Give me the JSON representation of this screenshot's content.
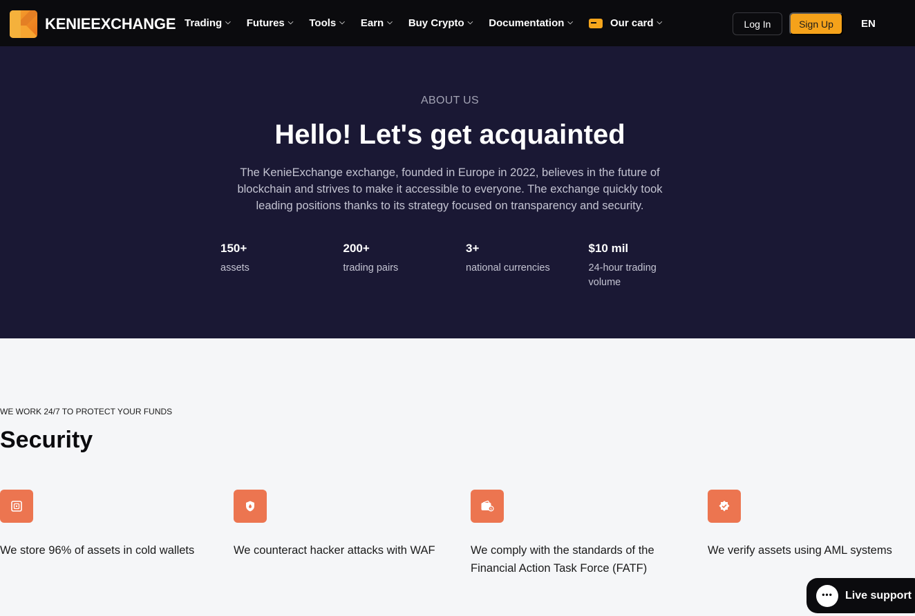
{
  "nav": {
    "brand": "KENIEEXCHANGE",
    "items": [
      {
        "label": "Trading"
      },
      {
        "label": "Futures"
      },
      {
        "label": "Tools"
      },
      {
        "label": "Earn"
      },
      {
        "label": "Buy Crypto"
      },
      {
        "label": "Documentation"
      },
      {
        "label": "Our card"
      }
    ],
    "login_label": "Log In",
    "signup_label": "Sign Up",
    "language": "EN"
  },
  "hero": {
    "eyebrow": "ABOUT US",
    "title": "Hello! Let's get acquainted",
    "description": "The KenieExchange exchange, founded in Europe in 2022, believes in the future of blockchain and strives to make it accessible to everyone. The exchange quickly took leading positions thanks to its strategy focused on transparency and security.",
    "stats": [
      {
        "value": "150+",
        "label": "assets"
      },
      {
        "value": "200+",
        "label": "trading pairs"
      },
      {
        "value": "3+",
        "label": "national currencies"
      },
      {
        "value": "$10 mil",
        "label": "24-hour trading volume"
      }
    ]
  },
  "security": {
    "eyebrow": "WE WORK 24/7 TO PROTECT YOUR FUNDS",
    "title": "Security",
    "features": [
      {
        "icon": "safe-icon",
        "text": "We store 96% of assets in cold wallets"
      },
      {
        "icon": "shield-icon",
        "text": "We counteract hacker attacks with WAF"
      },
      {
        "icon": "wallet-icon",
        "text": "We comply with the standards of the Financial Action Task Force (FATF)"
      },
      {
        "icon": "verified-badge-icon",
        "text": "We verify assets using AML systems"
      }
    ]
  },
  "live_support": {
    "label": "Live support"
  },
  "colors": {
    "nav_bg": "#0b0b0e",
    "hero_bg": "#1a1834",
    "accent_orange": "#f5a21a",
    "feature_icon_bg": "#ec7550",
    "page_bg": "#f5f6f8"
  }
}
